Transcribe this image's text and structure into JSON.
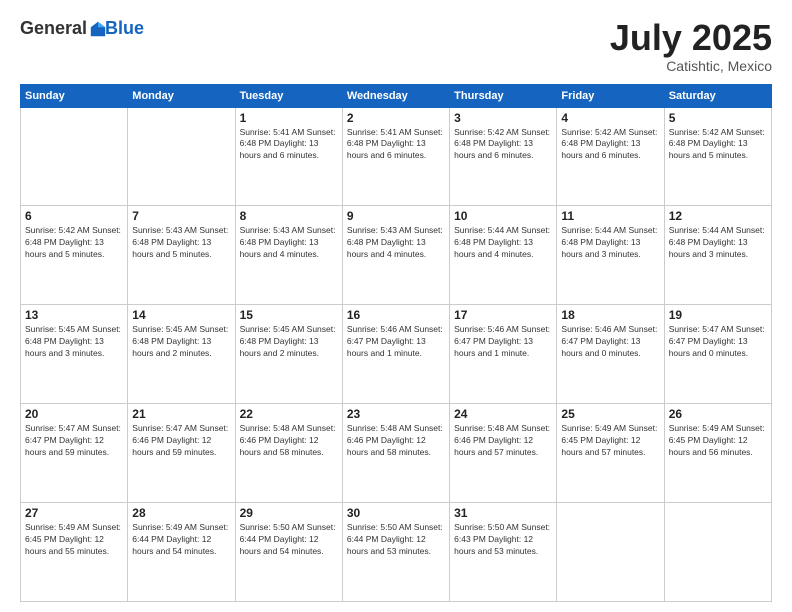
{
  "header": {
    "logo_general": "General",
    "logo_blue": "Blue",
    "title": "July 2025",
    "location": "Catishtic, Mexico"
  },
  "days_of_week": [
    "Sunday",
    "Monday",
    "Tuesday",
    "Wednesday",
    "Thursday",
    "Friday",
    "Saturday"
  ],
  "weeks": [
    [
      {
        "day": "",
        "info": ""
      },
      {
        "day": "",
        "info": ""
      },
      {
        "day": "1",
        "info": "Sunrise: 5:41 AM\nSunset: 6:48 PM\nDaylight: 13 hours\nand 6 minutes."
      },
      {
        "day": "2",
        "info": "Sunrise: 5:41 AM\nSunset: 6:48 PM\nDaylight: 13 hours\nand 6 minutes."
      },
      {
        "day": "3",
        "info": "Sunrise: 5:42 AM\nSunset: 6:48 PM\nDaylight: 13 hours\nand 6 minutes."
      },
      {
        "day": "4",
        "info": "Sunrise: 5:42 AM\nSunset: 6:48 PM\nDaylight: 13 hours\nand 6 minutes."
      },
      {
        "day": "5",
        "info": "Sunrise: 5:42 AM\nSunset: 6:48 PM\nDaylight: 13 hours\nand 5 minutes."
      }
    ],
    [
      {
        "day": "6",
        "info": "Sunrise: 5:42 AM\nSunset: 6:48 PM\nDaylight: 13 hours\nand 5 minutes."
      },
      {
        "day": "7",
        "info": "Sunrise: 5:43 AM\nSunset: 6:48 PM\nDaylight: 13 hours\nand 5 minutes."
      },
      {
        "day": "8",
        "info": "Sunrise: 5:43 AM\nSunset: 6:48 PM\nDaylight: 13 hours\nand 4 minutes."
      },
      {
        "day": "9",
        "info": "Sunrise: 5:43 AM\nSunset: 6:48 PM\nDaylight: 13 hours\nand 4 minutes."
      },
      {
        "day": "10",
        "info": "Sunrise: 5:44 AM\nSunset: 6:48 PM\nDaylight: 13 hours\nand 4 minutes."
      },
      {
        "day": "11",
        "info": "Sunrise: 5:44 AM\nSunset: 6:48 PM\nDaylight: 13 hours\nand 3 minutes."
      },
      {
        "day": "12",
        "info": "Sunrise: 5:44 AM\nSunset: 6:48 PM\nDaylight: 13 hours\nand 3 minutes."
      }
    ],
    [
      {
        "day": "13",
        "info": "Sunrise: 5:45 AM\nSunset: 6:48 PM\nDaylight: 13 hours\nand 3 minutes."
      },
      {
        "day": "14",
        "info": "Sunrise: 5:45 AM\nSunset: 6:48 PM\nDaylight: 13 hours\nand 2 minutes."
      },
      {
        "day": "15",
        "info": "Sunrise: 5:45 AM\nSunset: 6:48 PM\nDaylight: 13 hours\nand 2 minutes."
      },
      {
        "day": "16",
        "info": "Sunrise: 5:46 AM\nSunset: 6:47 PM\nDaylight: 13 hours\nand 1 minute."
      },
      {
        "day": "17",
        "info": "Sunrise: 5:46 AM\nSunset: 6:47 PM\nDaylight: 13 hours\nand 1 minute."
      },
      {
        "day": "18",
        "info": "Sunrise: 5:46 AM\nSunset: 6:47 PM\nDaylight: 13 hours\nand 0 minutes."
      },
      {
        "day": "19",
        "info": "Sunrise: 5:47 AM\nSunset: 6:47 PM\nDaylight: 13 hours\nand 0 minutes."
      }
    ],
    [
      {
        "day": "20",
        "info": "Sunrise: 5:47 AM\nSunset: 6:47 PM\nDaylight: 12 hours\nand 59 minutes."
      },
      {
        "day": "21",
        "info": "Sunrise: 5:47 AM\nSunset: 6:46 PM\nDaylight: 12 hours\nand 59 minutes."
      },
      {
        "day": "22",
        "info": "Sunrise: 5:48 AM\nSunset: 6:46 PM\nDaylight: 12 hours\nand 58 minutes."
      },
      {
        "day": "23",
        "info": "Sunrise: 5:48 AM\nSunset: 6:46 PM\nDaylight: 12 hours\nand 58 minutes."
      },
      {
        "day": "24",
        "info": "Sunrise: 5:48 AM\nSunset: 6:46 PM\nDaylight: 12 hours\nand 57 minutes."
      },
      {
        "day": "25",
        "info": "Sunrise: 5:49 AM\nSunset: 6:45 PM\nDaylight: 12 hours\nand 57 minutes."
      },
      {
        "day": "26",
        "info": "Sunrise: 5:49 AM\nSunset: 6:45 PM\nDaylight: 12 hours\nand 56 minutes."
      }
    ],
    [
      {
        "day": "27",
        "info": "Sunrise: 5:49 AM\nSunset: 6:45 PM\nDaylight: 12 hours\nand 55 minutes."
      },
      {
        "day": "28",
        "info": "Sunrise: 5:49 AM\nSunset: 6:44 PM\nDaylight: 12 hours\nand 54 minutes."
      },
      {
        "day": "29",
        "info": "Sunrise: 5:50 AM\nSunset: 6:44 PM\nDaylight: 12 hours\nand 54 minutes."
      },
      {
        "day": "30",
        "info": "Sunrise: 5:50 AM\nSunset: 6:44 PM\nDaylight: 12 hours\nand 53 minutes."
      },
      {
        "day": "31",
        "info": "Sunrise: 5:50 AM\nSunset: 6:43 PM\nDaylight: 12 hours\nand 53 minutes."
      },
      {
        "day": "",
        "info": ""
      },
      {
        "day": "",
        "info": ""
      }
    ]
  ]
}
